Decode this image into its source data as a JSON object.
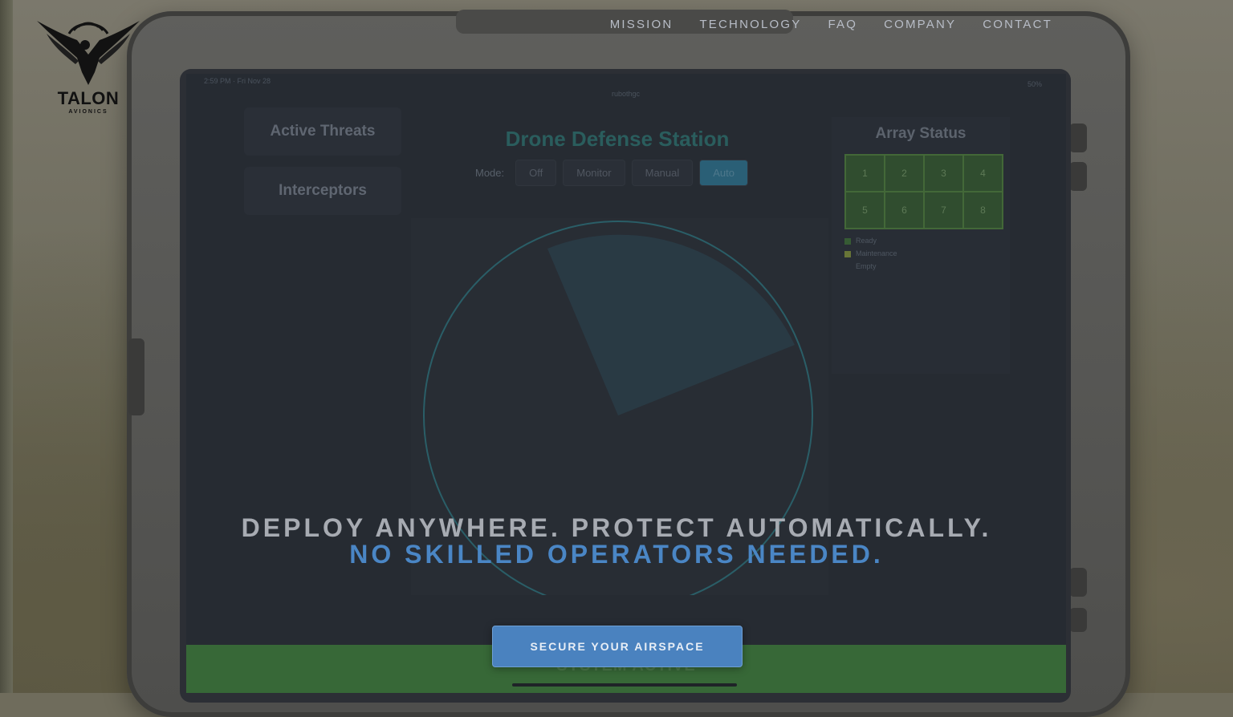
{
  "brand": {
    "name": "TALON",
    "tagline": "AVIONICS"
  },
  "nav": {
    "items": [
      "MISSION",
      "TECHNOLOGY",
      "FAQ",
      "COMPANY",
      "CONTACT"
    ]
  },
  "hero": {
    "line1": "DEPLOY ANYWHERE. PROTECT AUTOMATICALLY.",
    "line2": "NO SKILLED OPERATORS NEEDED.",
    "cta_label": "SECURE YOUR AIRSPACE"
  },
  "device_screen": {
    "status_left": "2:59 PM · Fri Nov 28",
    "status_center": "rubothgc",
    "status_right": "50%",
    "side_cards": [
      "Active Threats",
      "Interceptors"
    ],
    "title": "Drone Defense Station",
    "mode_label": "Mode:",
    "modes": [
      "Off",
      "Monitor",
      "Manual",
      "Auto"
    ],
    "active_mode": "Auto",
    "array_title": "Array Status",
    "array_cells": [
      "1",
      "2",
      "3",
      "4",
      "5",
      "6",
      "7",
      "8"
    ],
    "legend": [
      "Ready",
      "Maintenance",
      "Empty"
    ],
    "system_status": "SYSTEM ACTIVE"
  },
  "colors": {
    "accent": "#4a82bf",
    "hero_highlight": "#4a86c5",
    "nav_text": "#b8bdc7"
  }
}
